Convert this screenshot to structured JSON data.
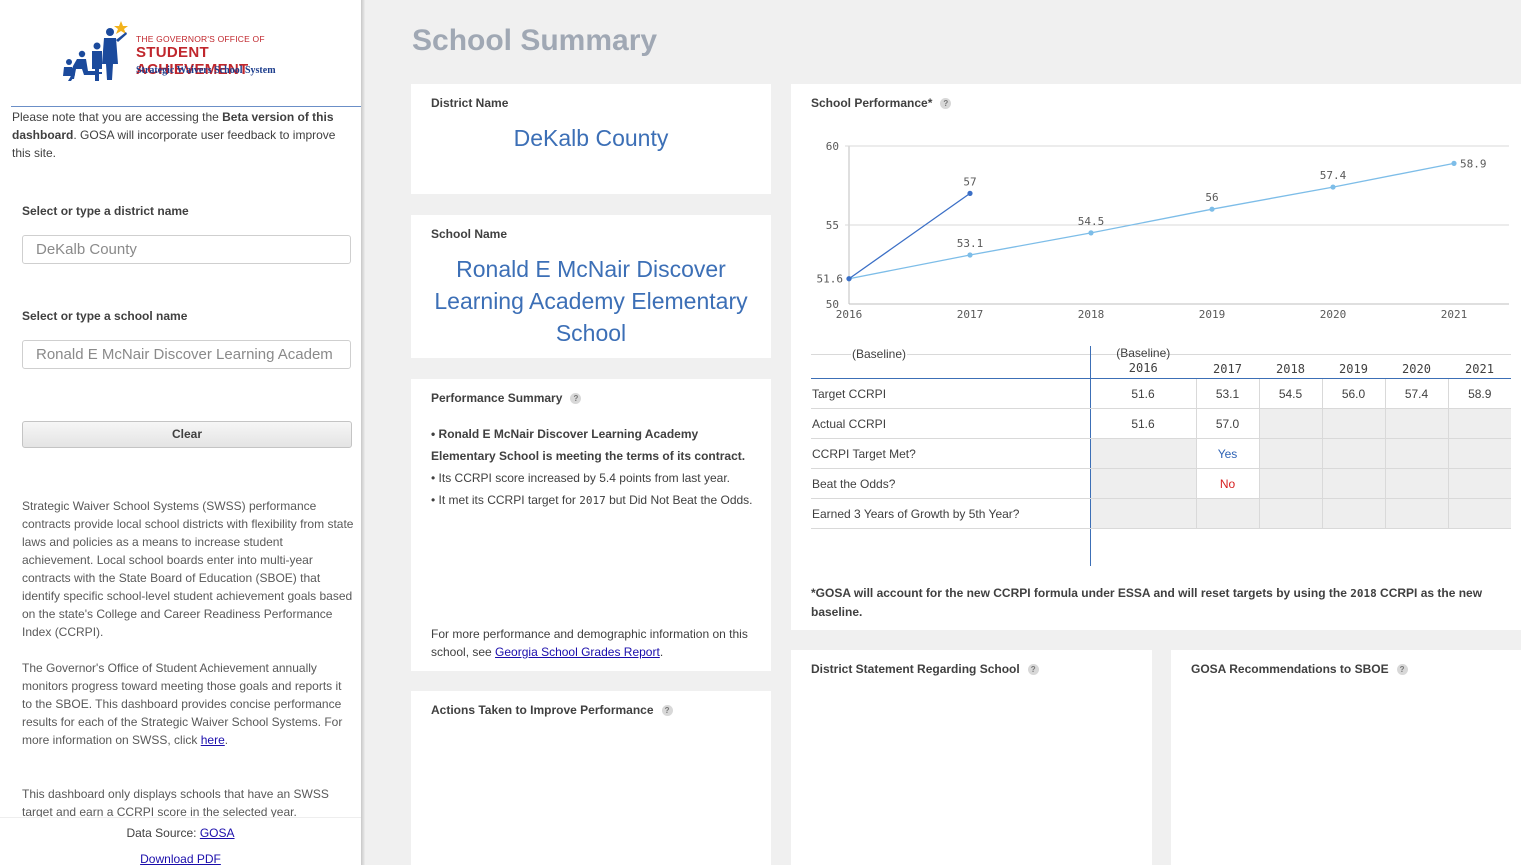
{
  "logo": {
    "line1": "THE GOVERNOR'S OFFICE OF",
    "line2": "STUDENT ACHIEVEMENT",
    "line3": "Strategic Waivers School System"
  },
  "sidebar": {
    "beta_note_prefix": "Please note that you are accessing the ",
    "beta_note_bold": "Beta version of this dashboard",
    "beta_note_suffix": ". GOSA will incorporate user feedback to improve this site.",
    "district_label": "Select or type a district name",
    "district_value": "DeKalb County",
    "school_label": "Select or type a school name",
    "school_value": "Ronald E McNair Discover Learning Academ",
    "clear_label": "Clear",
    "para1": "Strategic Waiver School Systems (SWSS) performance contracts provide local school districts with flexibility from state laws and policies as a means to increase student achievement. Local school boards enter into multi-year contracts with the State Board of Education (SBOE) that identify specific school-level student achievement goals based on the state's College and Career Readiness Performance Index (CCRPI).",
    "para2_text": "The Governor's Office of Student Achievement annually monitors progress toward meeting those goals and reports it to the SBOE. This dashboard provides concise performance results for each of the Strategic Waiver School Systems. For more information on SWSS, click ",
    "para2_link": "here",
    "para3": "This dashboard only displays schools that have an SWSS target and earn a CCRPI score in the selected year.",
    "data_source_label": "Data Source: ",
    "data_source_link": "GOSA",
    "download_label": "Download PDF"
  },
  "page_title": "School Summary",
  "district_panel": {
    "title": "District Name",
    "value": "DeKalb County"
  },
  "school_panel": {
    "title": "School Name",
    "value": "Ronald E McNair Discover Learning Academy Elementary School"
  },
  "summary_panel": {
    "title": "Performance Summary",
    "bullet1": "• Ronald E McNair Discover Learning Academy Elementary School is meeting the terms of its contract.",
    "bullet2": "• Its CCRPI score increased by 5.4 points from last year.",
    "bullet3_a": "• It met its CCRPI target for ",
    "bullet3_year": "2017",
    "bullet3_b": " but Did Not Beat the Odds.",
    "more_text": "For more performance and demographic information on this school, see ",
    "more_link": "Georgia School Grades Report",
    "more_end": "."
  },
  "actions_panel": {
    "title": "Actions Taken to Improve Performance"
  },
  "district_statement_panel": {
    "title": "District Statement Regarding School"
  },
  "gosa_panel": {
    "title": "GOSA Recommendations to SBOE"
  },
  "performance_panel": {
    "title": "School Performance*",
    "baseline_label": "(Baseline)",
    "table": {
      "baseline_note": "(Baseline)",
      "years": [
        "2016",
        "2017",
        "2018",
        "2019",
        "2020",
        "2021"
      ],
      "rows": [
        {
          "label": "Target CCRPI",
          "values": [
            "51.6",
            "53.1",
            "54.5",
            "56.0",
            "57.4",
            "58.9"
          ]
        },
        {
          "label": "Actual CCRPI",
          "values": [
            "51.6",
            "57.0",
            "",
            "",
            "",
            ""
          ]
        },
        {
          "label": "CCRPI Target Met?",
          "values": [
            "",
            "Yes",
            "",
            "",
            "",
            ""
          ]
        },
        {
          "label": "Beat the Odds?",
          "values": [
            "",
            "No",
            "",
            "",
            "",
            ""
          ]
        },
        {
          "label": "Earned 3 Years of Growth by 5th Year?",
          "values": [
            "",
            "",
            "",
            "",
            "",
            ""
          ]
        }
      ]
    },
    "footnote_a": "*GOSA will account for the new CCRPI formula under ESSA and will reset targets by using the ",
    "footnote_year": "2018",
    "footnote_b": " CCRPI as the new baseline."
  },
  "chart_data": {
    "type": "line",
    "x": [
      2016,
      2017,
      2018,
      2019,
      2020,
      2021
    ],
    "ylim": [
      50,
      60
    ],
    "yticks": [
      50,
      55,
      60
    ],
    "grid": true,
    "series": [
      {
        "values": [
          51.6,
          53.1,
          54.5,
          56,
          57.4,
          58.9
        ],
        "labels": [
          "51.6",
          "53.1",
          "54.5",
          "56",
          "57.4",
          "58.9"
        ],
        "color": "#7dbde8"
      },
      {
        "values": [
          51.6,
          57,
          null,
          null,
          null,
          null
        ],
        "labels": [
          "",
          "57",
          "",
          "",
          "",
          ""
        ],
        "color": "#3b6fc6"
      }
    ]
  }
}
